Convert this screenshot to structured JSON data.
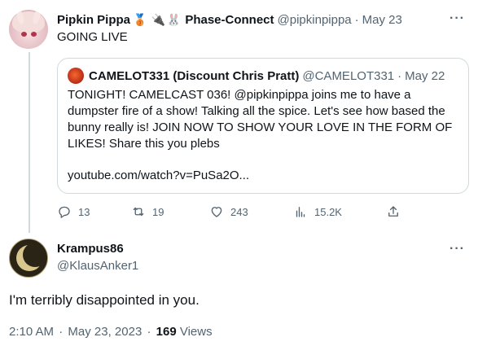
{
  "original_tweet": {
    "author_name": "Pipkin Pippa",
    "author_badges": [
      "🥉",
      "🔌",
      "🐰"
    ],
    "affiliation": "Phase-Connect",
    "handle": "@pipkinpippa",
    "separator": "·",
    "date": "May 23",
    "text": "GOING LIVE",
    "more_label": "···"
  },
  "quoted_tweet": {
    "author_name": "CAMELOT331 (Discount Chris Pratt)",
    "handle": "@CAMELOT331",
    "separator": "·",
    "date": "May 22",
    "text": "TONIGHT! CAMELCAST 036! @pipkinpippa joins me to have a dumpster fire of a show! Talking all the spice. Let's see how based the bunny really is! JOIN NOW TO SHOW YOUR LOVE IN THE FORM OF LIKES! Share this you plebs",
    "link": "youtube.com/watch?v=PuSa2O..."
  },
  "actions": {
    "replies": "13",
    "retweets": "19",
    "likes": "243",
    "views": "15.2K"
  },
  "reply_tweet": {
    "author_name": "Krampus86",
    "handle": "@KlausAnker1",
    "text": "I'm terribly disappointed in you.",
    "time": "2:10 AM",
    "separator": "·",
    "date": "May 23, 2023",
    "views_count": "169",
    "views_label": "Views",
    "more_label": "···"
  },
  "colors": {
    "text_primary": "#0f1419",
    "text_muted": "#536471",
    "border": "#cfd9de"
  }
}
